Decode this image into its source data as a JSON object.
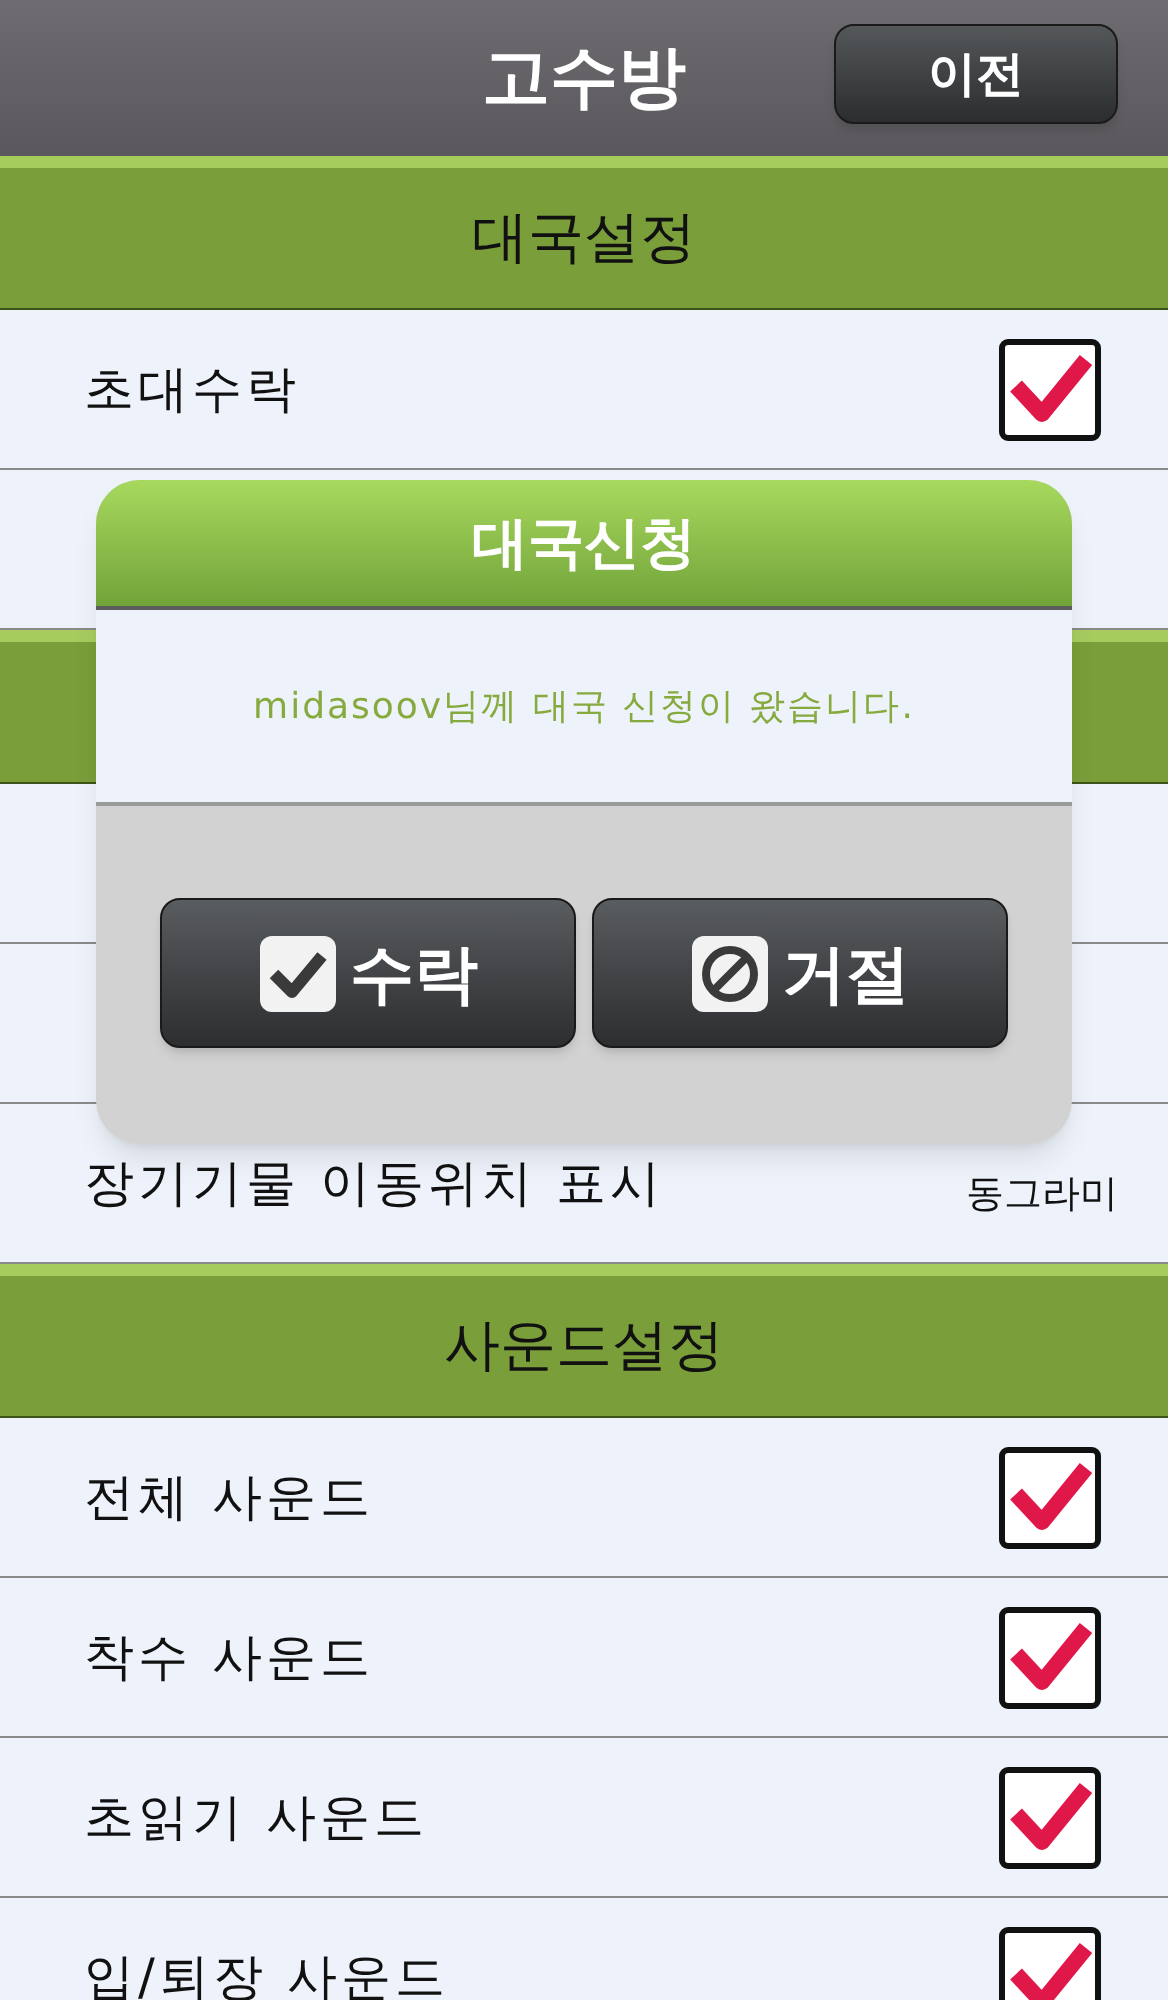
{
  "header": {
    "title": "고수방",
    "back_button": "이전"
  },
  "sections": [
    {
      "title": "대국설정",
      "rows": [
        {
          "kind": "checkbox",
          "label": "초대수락",
          "checked": true
        },
        {
          "kind": "covered"
        }
      ]
    },
    {
      "rows": [
        {
          "kind": "covered"
        },
        {
          "kind": "covered"
        },
        {
          "kind": "value",
          "label": "장기기물 이동위치 표시",
          "value": "동그라미"
        }
      ]
    },
    {
      "title": "사운드설정",
      "rows": [
        {
          "kind": "checkbox",
          "label": "전체 사운드",
          "checked": true
        },
        {
          "kind": "checkbox",
          "label": "착수 사운드",
          "checked": true
        },
        {
          "kind": "checkbox",
          "label": "초읽기 사운드",
          "checked": true
        },
        {
          "kind": "checkbox",
          "label": "입/퇴장 사운드",
          "checked": true
        }
      ]
    }
  ],
  "dialog": {
    "title": "대국신청",
    "message": "midasoov님께 대국 신청이 왔습니다.",
    "buttons": [
      {
        "kind": "accept",
        "label": "수락"
      },
      {
        "kind": "reject",
        "label": "거절"
      }
    ]
  }
}
